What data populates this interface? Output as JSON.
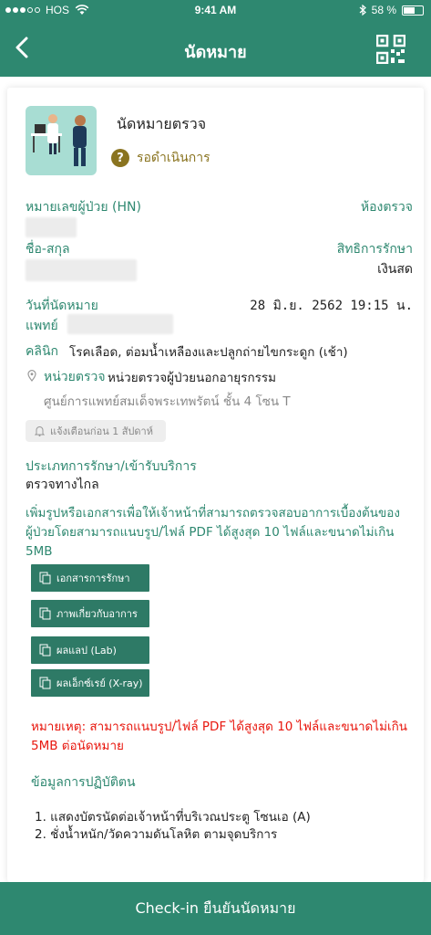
{
  "status_bar": {
    "carrier": "HOS",
    "time": "9:41 AM",
    "battery": "58 %",
    "battery_level": 0.58
  },
  "header": {
    "title": "นัดหมาย"
  },
  "appointment": {
    "title": "นัดหมายตรวจ",
    "status": "รอดำเนินการ",
    "hn_label": "หมายเลขผู้ป่วย (HN)",
    "room_label": "ห้องตรวจ",
    "name_label": "ชื่อ-สกุล",
    "rights_label": "สิทธิการรักษา",
    "rights_value": "เงินสด",
    "date_label": "วันที่นัดหมาย",
    "date_value": "28 มิ.ย. 2562 19:15 น.",
    "doctor_label": "แพทย์",
    "clinic_label": "คลินิก",
    "clinic_value": "โรคเลือด, ต่อมน้ำเหลืองและปลูกถ่ายไขกระดูก (เช้า)",
    "unit_label": "หน่วยตรวจ",
    "unit_value": "หน่วยตรวจผู้ป่วยนอกอายุรกรรม",
    "location": "ศูนย์การแพทย์สมเด็จพระเทพรัตน์ ชั้น 4 โซน T",
    "reminder": "แจ้งเตือนก่อน 1 สัปดาห์",
    "service_type_label": "ประเภทการรักษา/เข้ารับบริการ",
    "service_type_value": "ตรวจทางไกล"
  },
  "upload": {
    "instruction_line1": "เพิ่มรูปหรือเอกสารเพื่อให้เจ้าหน้าที่สามารถตรวจสอบอาการเบื้องต้นของ",
    "instruction_line2": "ผู้ป่วยโดยสามารถแนบรูป/ไฟล์ PDF ได้สูงสุด 10 ไฟล์และขนาดไม่เกิน 5MB",
    "buttons": [
      {
        "label": "เอกสารการรักษา"
      },
      {
        "label": "ภาพเกี่ยวกับอาการ"
      },
      {
        "label": "ผลแลป (Lab)"
      },
      {
        "label": "ผลเอ็กซ์เรย์ (X-ray)"
      }
    ],
    "note_line1": "หมายเหตุ: สามารถแนบรูป/ไฟล์ PDF ได้สูงสุด 10 ไฟล์และขนาดไม่เกิน",
    "note_line2": "5MB ต่อนัดหมาย"
  },
  "practice": {
    "heading": "ข้อมูลการปฏิบัติตน",
    "items": [
      "1. แสดงบัตรนัดต่อเจ้าหน้าที่บริเวณประตู โซนเอ (A)",
      "2. ชั่งน้ำหนัก/วัดความดันโลหิต ตามจุดบริการ"
    ]
  },
  "footer": {
    "checkin_label": "Check-in ยืนยันนัดหมาย"
  },
  "colors": {
    "primary": "#2e8870",
    "status": "#8a7420",
    "warning": "#e8170e"
  }
}
